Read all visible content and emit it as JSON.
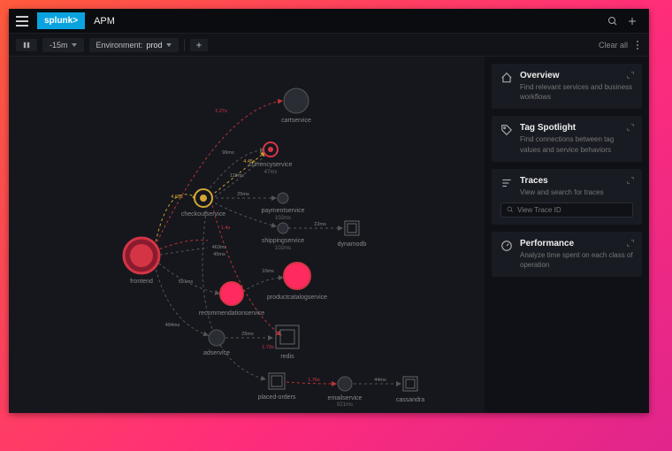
{
  "brand": "splunk>",
  "appTitle": "APM",
  "toolbar": {
    "timeRange": "-15m",
    "envLabel": "Environment:",
    "envValue": "prod",
    "clearAll": "Clear all"
  },
  "sidebar": {
    "overview": {
      "title": "Overview",
      "desc": "Find relevant services and business workflows"
    },
    "tagSpotlight": {
      "title": "Tag Spotlight",
      "desc": "Find connections between tag values and service behaviors"
    },
    "traces": {
      "title": "Traces",
      "desc": "View and search for traces",
      "placeholder": "View Trace ID"
    },
    "performance": {
      "title": "Performance",
      "desc": "Analyze time spent on each class of operation"
    }
  },
  "nodes": {
    "frontend": "frontend",
    "cartservice": "cartservice",
    "currencyservice": "currencyservice",
    "currencyservice_t": "47ms",
    "checkoutservice": "checkoutservice",
    "paymentservice": "paymentservice",
    "paymentservice_t": "102ms",
    "shippingservice": "shippingservice",
    "shippingservice_t": "102ms",
    "dynamodb": "dynamodb",
    "productcatalogservice": "productcatalogservice",
    "recommendationservice": "recommendationservice",
    "adservice": "adservice",
    "redis": "redis",
    "placedorders": "placed-orders",
    "emailservice": "emailservice",
    "emailservice_t": "921ms",
    "cassandra": "cassandra"
  },
  "edges": {
    "e1": "2.27s",
    "e2": "96ms",
    "e3": "4.45s",
    "e4": "119ms",
    "e5": "25ms",
    "e6": "4.65s",
    "e7": "1.4s",
    "e8": "463ms",
    "e9": "45ms",
    "e10": "22ms",
    "e11": "591ms",
    "e12": "10ms",
    "e13": "494ms",
    "e14": "25ms",
    "e15": "1.73s",
    "e16": "1.76s",
    "e17": "44ms"
  }
}
